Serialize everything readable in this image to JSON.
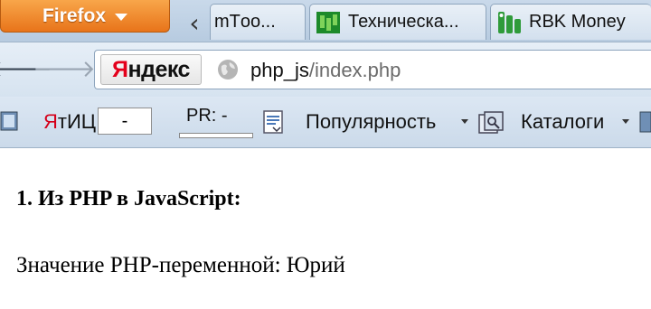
{
  "browser": {
    "menu_button_label": "Firefox",
    "tabs": [
      {
        "label": "mTоо..."
      },
      {
        "label": "Техническа..."
      },
      {
        "label": "RBK Money"
      }
    ]
  },
  "navbar": {
    "yandex_logo_first": "Я",
    "yandex_logo_rest": "ндекс",
    "url_host": "php_js",
    "url_path": "/index.php"
  },
  "yandex_bar": {
    "tic_prefix": "Я",
    "tic_label": "тИЦ:",
    "tic_value": "-",
    "pr_label": "PR: -",
    "popularity_label": "Популярность",
    "catalogs_label": "Каталоги"
  },
  "page": {
    "heading": "1. Из PHP в JavaScript:",
    "paragraph": "Значение PHP-переменной: Юрий"
  },
  "colors": {
    "firefox_orange": "#e8741a",
    "yandex_red": "#e4001b",
    "chrome_blue": "#d6e3f0"
  }
}
